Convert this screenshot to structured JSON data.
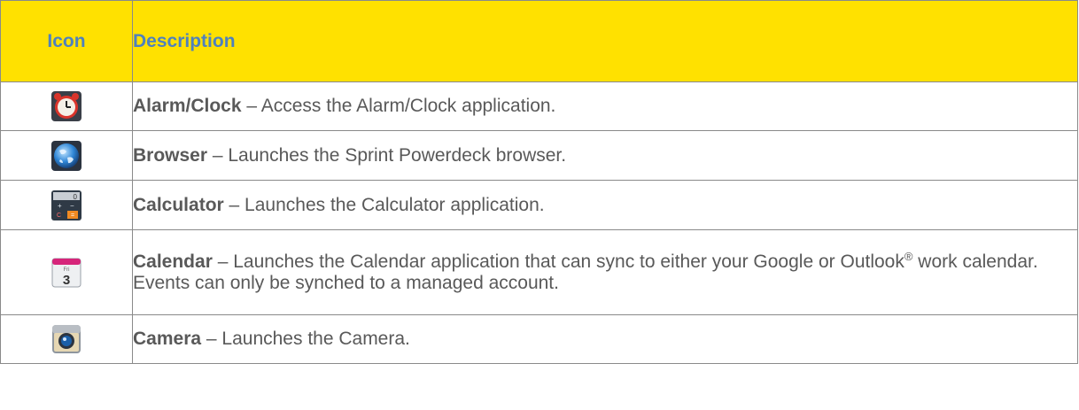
{
  "table": {
    "header_icon": "Icon",
    "header_description": "Description",
    "accent_color": "#ffe100",
    "header_text_color": "#4f81bd",
    "rows": [
      {
        "icon": "alarm-clock-icon",
        "name": "Alarm/Clock",
        "description": " – Access the Alarm/Clock application."
      },
      {
        "icon": "browser-globe-icon",
        "name": "Browser",
        "description": " – Launches the Sprint Powerdeck browser."
      },
      {
        "icon": "calculator-icon",
        "name": "Calculator",
        "description": " – Launches the Calculator application."
      },
      {
        "icon": "calendar-icon",
        "name": "Calendar",
        "description": " – Launches the Calendar application that can sync to either your Google or Outlook",
        "superscript": "®",
        "description_after": " work calendar. Events can only be synched to a managed account.",
        "icon_day": "Fri",
        "icon_date": "3"
      },
      {
        "icon": "camera-icon",
        "name": "Camera",
        "description": " – Launches the Camera."
      }
    ]
  }
}
